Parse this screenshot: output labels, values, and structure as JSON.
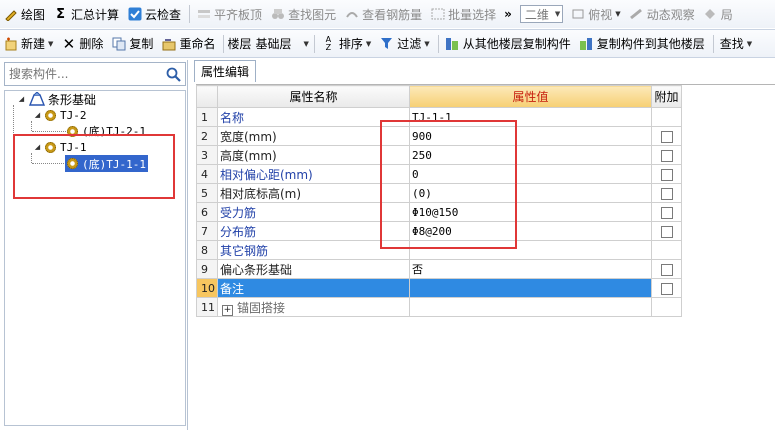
{
  "toolbar1": {
    "items": [
      "绘图",
      "汇总计算",
      "云检查",
      "平齐板顶",
      "查找图元",
      "查看钢筋量",
      "批量选择"
    ],
    "overflow": "»",
    "view_combo": "二维",
    "view_top": "俯视",
    "dynamic": "动态观察",
    "cut_off": "局"
  },
  "toolbar2": {
    "new": "新建",
    "delete": "删除",
    "copy": "复制",
    "rename": "重命名",
    "floor_label": "楼层",
    "floor_value": "基础层",
    "sort": "排序",
    "filter": "过滤",
    "copy_from": "从其他楼层复制构件",
    "copy_to": "复制构件到其他楼层",
    "find": "查找"
  },
  "left": {
    "search_placeholder": "搜索构件...",
    "tree": {
      "root": "条形基础",
      "tj2": "TJ-2",
      "tj2_child": "(底)TJ-2-1",
      "tj1": "TJ-1",
      "tj1_child": "(底)TJ-1-1"
    }
  },
  "tab": "属性编辑",
  "table": {
    "headers": [
      "",
      "属性名称",
      "属性值",
      "附加"
    ],
    "rows": [
      {
        "n": "1",
        "name": "名称",
        "value": "TJ-1-1",
        "check": false
      },
      {
        "n": "2",
        "name": "宽度(mm)",
        "value": "900",
        "check": true
      },
      {
        "n": "3",
        "name": "高度(mm)",
        "value": "250",
        "check": true
      },
      {
        "n": "4",
        "name": "相对偏心距(mm)",
        "value": "0",
        "check": true
      },
      {
        "n": "5",
        "name": "相对底标高(m)",
        "value": "(0)",
        "check": true
      },
      {
        "n": "6",
        "name": "受力筋",
        "value": "Φ10@150",
        "check": true
      },
      {
        "n": "7",
        "name": "分布筋",
        "value": "Φ8@200",
        "check": true
      },
      {
        "n": "8",
        "name": "其它钢筋",
        "value": "",
        "check": false
      },
      {
        "n": "9",
        "name": "偏心条形基础",
        "value": "否",
        "check": true
      },
      {
        "n": "10",
        "name": "备注",
        "value": "",
        "check": true
      },
      {
        "n": "11",
        "name": "锚固搭接",
        "value": "",
        "check": false
      }
    ]
  },
  "colors": {
    "accent_red": "#e03737",
    "selection_blue": "#2f8ae2",
    "header_orange": "#f6cf73"
  }
}
